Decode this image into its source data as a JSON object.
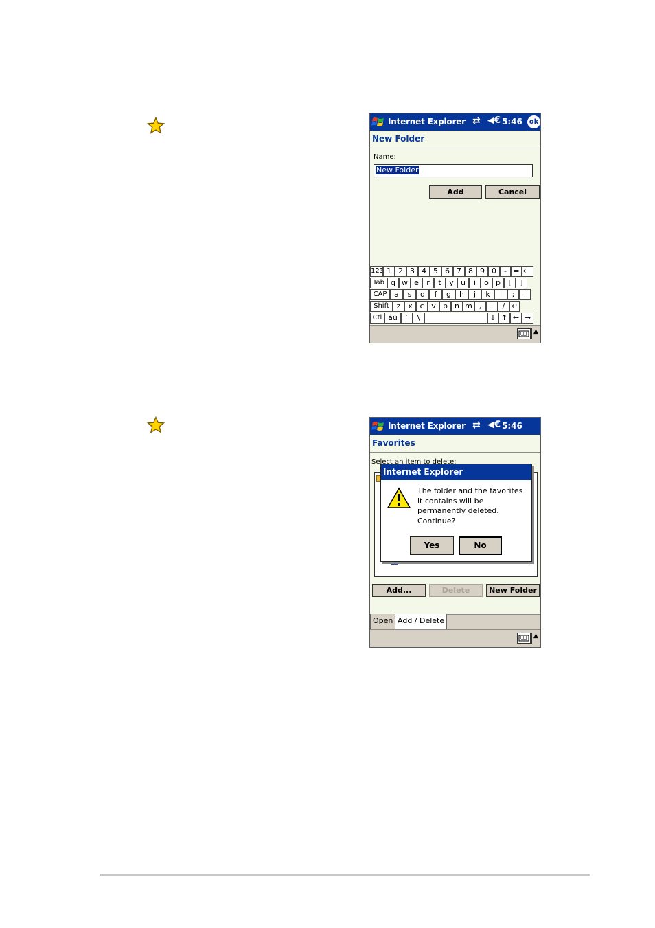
{
  "page": {
    "step_icon": "star-icon",
    "screen1": {
      "titlebar": {
        "title": "Internet Explorer",
        "sync_icon": "⇄",
        "speaker_icon": "◀€",
        "time": "5:46",
        "ok_label": "ok"
      },
      "heading": "New Folder",
      "name_label": "Name:",
      "name_value": "New Folder",
      "add_label": "Add",
      "cancel_label": "Cancel",
      "keyboard": {
        "row1": [
          "123",
          "1",
          "2",
          "3",
          "4",
          "5",
          "6",
          "7",
          "8",
          "9",
          "0",
          "-",
          "=",
          "🡐"
        ],
        "row2": [
          "Tab",
          "q",
          "w",
          "e",
          "r",
          "t",
          "y",
          "u",
          "i",
          "o",
          "p",
          "[",
          "]"
        ],
        "row3": [
          "CAP",
          "a",
          "s",
          "d",
          "f",
          "g",
          "h",
          "j",
          "k",
          "l",
          ";",
          "'"
        ],
        "row4": [
          "Shift",
          "z",
          "x",
          "c",
          "v",
          "b",
          "n",
          "m",
          ",",
          ".",
          "/",
          "↵"
        ],
        "row5": [
          "Ctl",
          "áü",
          "`",
          "\\",
          "↓",
          "↑",
          "←",
          "→"
        ]
      },
      "sip_up": "▲"
    },
    "screen2": {
      "titlebar": {
        "title": "Internet Explorer",
        "sync_icon": "⇄",
        "speaker_icon": "◀€",
        "time": "5:46"
      },
      "heading": "Favorites",
      "select_label": "Select an item to delete:",
      "dialog": {
        "title": "Internet Explorer",
        "message": "The folder and the favorites it contains will be permanently deleted. Continue?",
        "yes_label": "Yes",
        "no_label": "No"
      },
      "add_label": "Add...",
      "delete_label": "Delete",
      "new_folder_label": "New Folder",
      "tabs": [
        "Open",
        "Add / Delete"
      ],
      "sip_up": "▲"
    }
  }
}
